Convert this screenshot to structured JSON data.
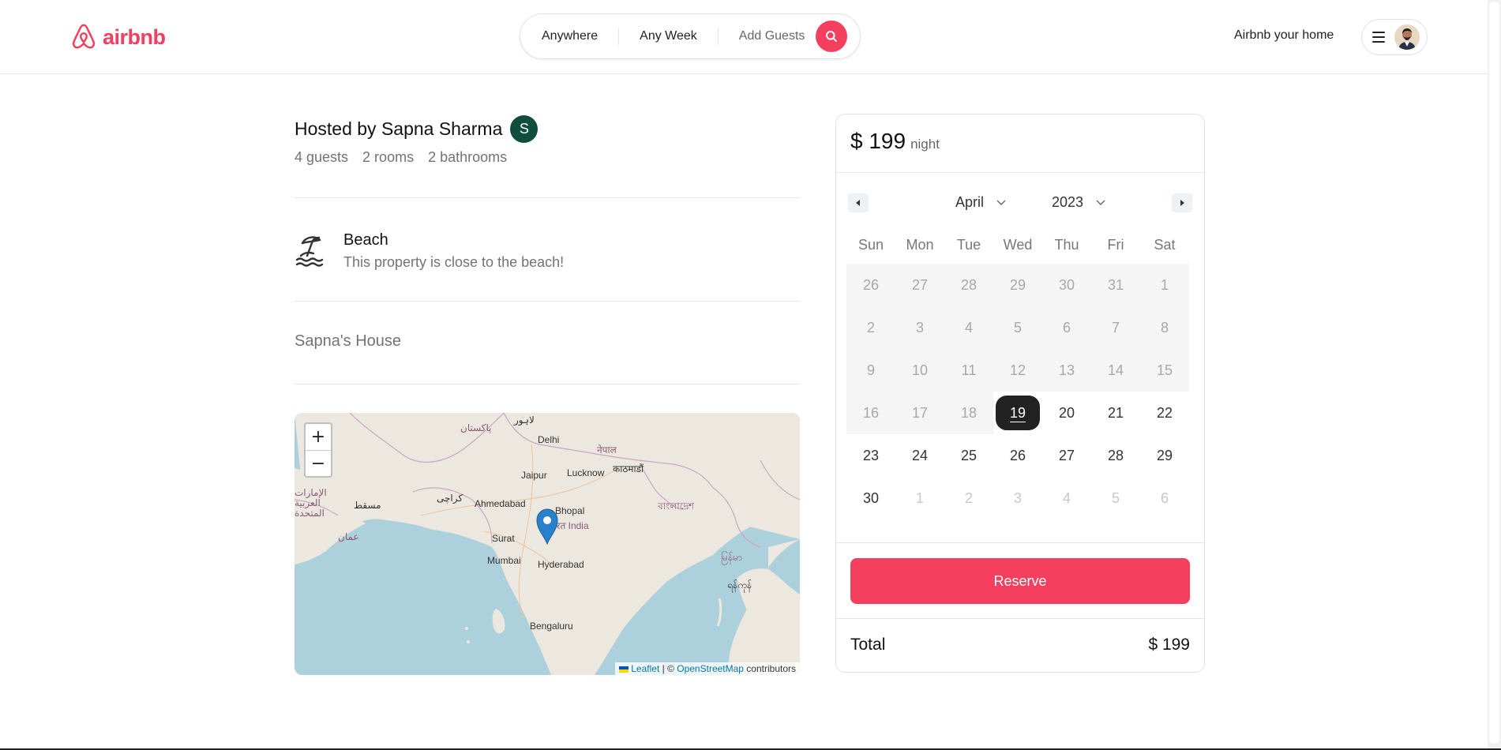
{
  "brand": {
    "name": "airbnb",
    "color": "#f43f5e",
    "icon": "airbnb-logo-icon"
  },
  "search": {
    "anywhere": "Anywhere",
    "any_week": "Any Week",
    "add_guests": "Add Guests",
    "icon": "search-icon"
  },
  "header": {
    "host_link": "Airbnb your home",
    "menu_icon": "hamburger-icon",
    "avatar": "user-avatar"
  },
  "listing": {
    "host_title": "Hosted by Sapna Sharma",
    "host_initial": "S",
    "stats": [
      "4 guests",
      "2 rooms",
      "2 bathrooms"
    ],
    "category": {
      "icon": "beach-umbrella-icon",
      "title": "Beach",
      "description": "This property is close to the beach!"
    },
    "name": "Sapna's House"
  },
  "map": {
    "zoom_in": "+",
    "zoom_out": "−",
    "labels": [
      "پاکستان",
      "لاہور",
      "Delhi",
      "नेपाल",
      "काठमाडौं",
      "Jaipur",
      "Lucknow",
      "الإمارات العربية المتحدة",
      "مسقط",
      "كراچی",
      "Ahmedabad",
      "Bhopal",
      "भारत India",
      "বাংলাদেশ",
      "عمان",
      "Surat",
      "Mumbai",
      "Hyderabad",
      "မြန်မာ",
      "ရန်ကုန်",
      "Bengaluru"
    ],
    "attribution": {
      "leaflet": "Leaflet",
      "separator": " | © ",
      "osm": "OpenStreetMap",
      "suffix": " contributors"
    }
  },
  "reservation": {
    "price": "$ 199",
    "price_unit": "night",
    "calendar": {
      "month": "April",
      "year": "2023",
      "weekdays": [
        "Sun",
        "Mon",
        "Tue",
        "Wed",
        "Thu",
        "Fri",
        "Sat"
      ],
      "days": [
        {
          "d": "26",
          "s": "disabled"
        },
        {
          "d": "27",
          "s": "disabled"
        },
        {
          "d": "28",
          "s": "disabled"
        },
        {
          "d": "29",
          "s": "disabled"
        },
        {
          "d": "30",
          "s": "disabled"
        },
        {
          "d": "31",
          "s": "disabled"
        },
        {
          "d": "1",
          "s": "disabled"
        },
        {
          "d": "2",
          "s": "disabled"
        },
        {
          "d": "3",
          "s": "disabled"
        },
        {
          "d": "4",
          "s": "disabled"
        },
        {
          "d": "5",
          "s": "disabled"
        },
        {
          "d": "6",
          "s": "disabled"
        },
        {
          "d": "7",
          "s": "disabled"
        },
        {
          "d": "8",
          "s": "disabled"
        },
        {
          "d": "9",
          "s": "disabled"
        },
        {
          "d": "10",
          "s": "disabled"
        },
        {
          "d": "11",
          "s": "disabled"
        },
        {
          "d": "12",
          "s": "disabled"
        },
        {
          "d": "13",
          "s": "disabled"
        },
        {
          "d": "14",
          "s": "disabled"
        },
        {
          "d": "15",
          "s": "disabled"
        },
        {
          "d": "16",
          "s": "disabled"
        },
        {
          "d": "17",
          "s": "disabled"
        },
        {
          "d": "18",
          "s": "disabled"
        },
        {
          "d": "19",
          "s": "selected"
        },
        {
          "d": "20",
          "s": "normal"
        },
        {
          "d": "21",
          "s": "normal"
        },
        {
          "d": "22",
          "s": "normal"
        },
        {
          "d": "23",
          "s": "normal"
        },
        {
          "d": "24",
          "s": "normal"
        },
        {
          "d": "25",
          "s": "normal"
        },
        {
          "d": "26",
          "s": "normal"
        },
        {
          "d": "27",
          "s": "normal"
        },
        {
          "d": "28",
          "s": "normal"
        },
        {
          "d": "29",
          "s": "normal"
        },
        {
          "d": "30",
          "s": "normal"
        },
        {
          "d": "1",
          "s": "outside"
        },
        {
          "d": "2",
          "s": "outside"
        },
        {
          "d": "3",
          "s": "outside"
        },
        {
          "d": "4",
          "s": "outside"
        },
        {
          "d": "5",
          "s": "outside"
        },
        {
          "d": "6",
          "s": "outside"
        }
      ]
    },
    "reserve_label": "Reserve",
    "total_label": "Total",
    "total_value": "$ 199"
  }
}
